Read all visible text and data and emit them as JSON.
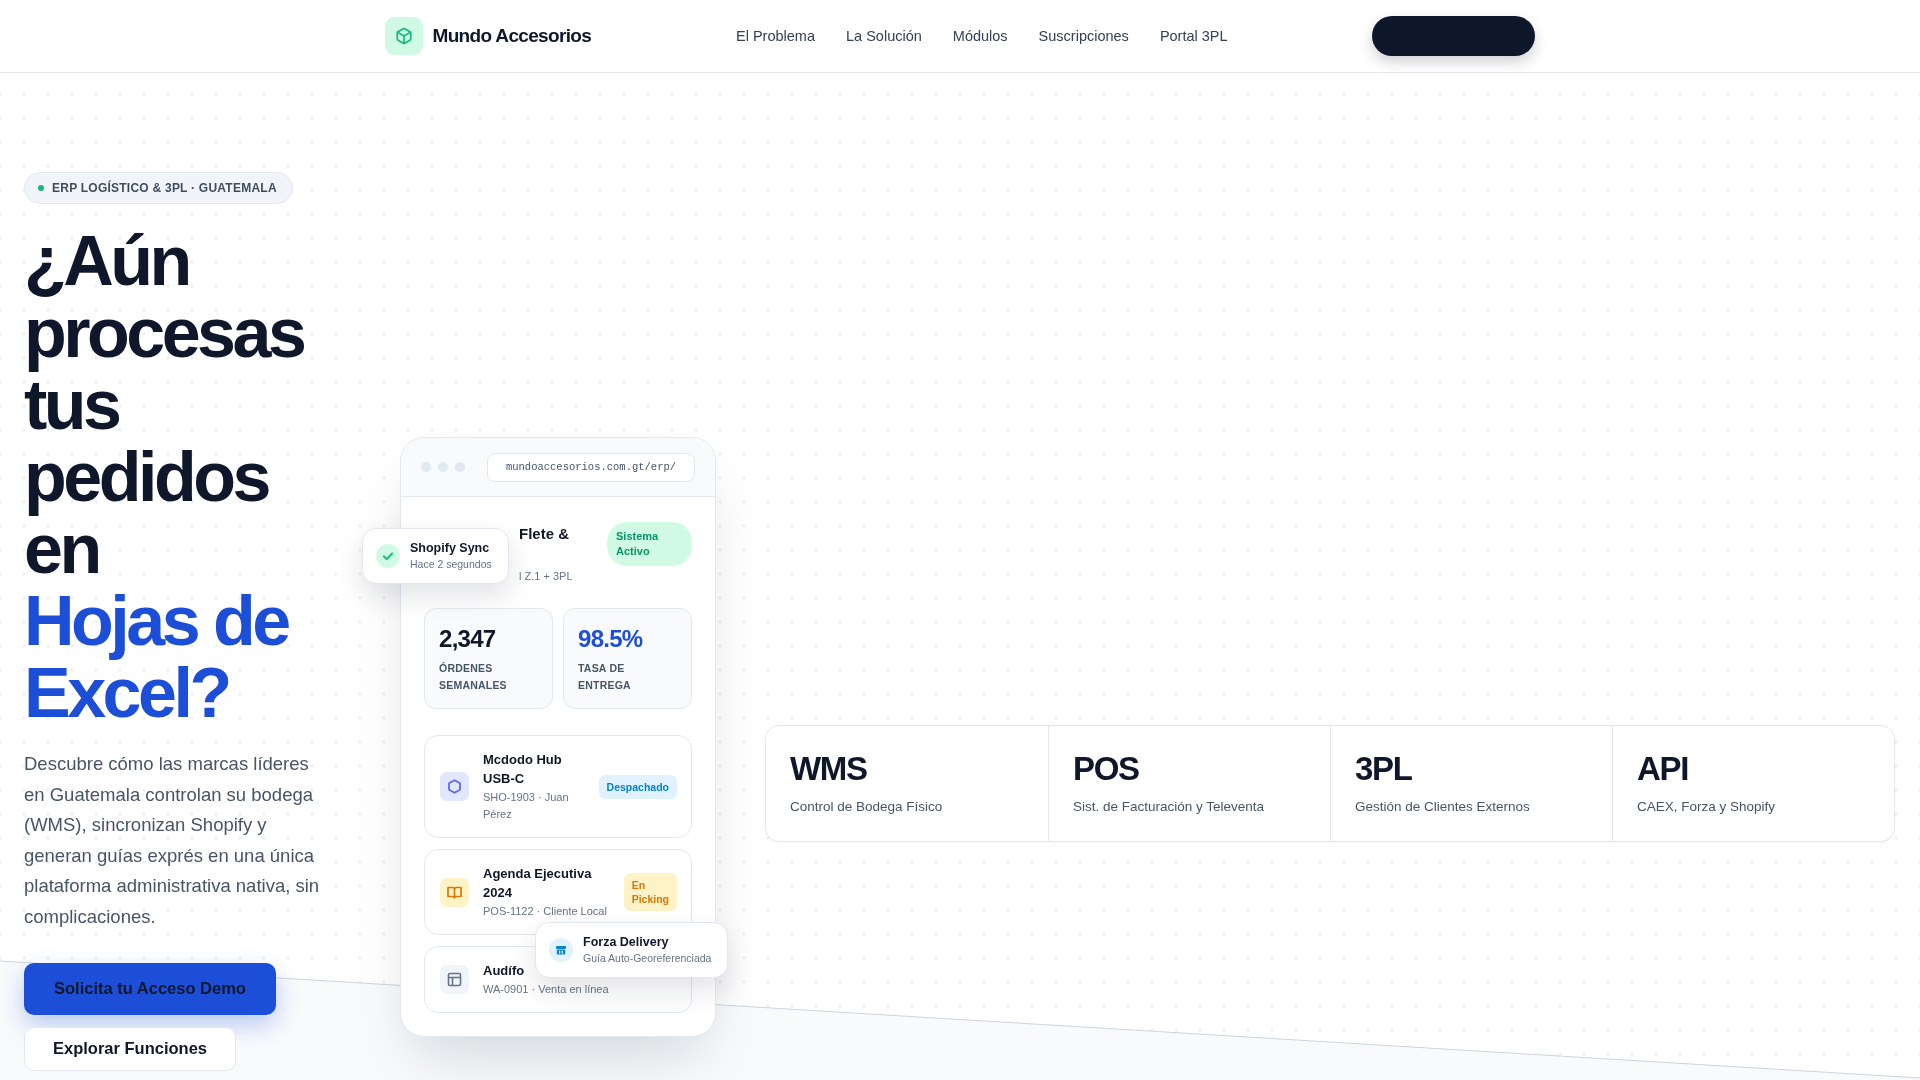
{
  "header": {
    "brand": "Mundo Accesorios",
    "nav": [
      "El Problema",
      "La Solución",
      "Módulos",
      "Suscripciones",
      "Portal 3PL"
    ]
  },
  "hero": {
    "badge": "ERP LOGÍSTICO & 3PL · GUATEMALA",
    "heading": "¿Aún procesas tus pedidos en",
    "heading_highlight": "Hojas de Excel?",
    "description": "Descubre cómo las marcas líderes en Guatemala controlan su bodega (WMS), sincronizan Shopify y generan guías exprés en una única plataforma administrativa nativa, sin complicaciones.",
    "buttons": [
      {
        "label": "Solicita tu Acceso Demo",
        "kind": "primary"
      },
      {
        "label": "Explorar Funciones",
        "kind": "secondary"
      }
    ]
  },
  "dashboard_preview": {
    "url": "mundoaccesorios.com.gt/erp/",
    "title": "Flete &",
    "subtitle": "l Z.1 + 3PL",
    "status": "Sistema Activo",
    "stats": [
      {
        "value": "2,347",
        "label": "ÓRDENES SEMANALES",
        "kind": "neutral"
      },
      {
        "value": "98.5%",
        "label": "TASA DE ENTREGA",
        "kind": "accent"
      }
    ],
    "orders": [
      {
        "product": "Mcdodo Hub USB-C",
        "detail": "SHO-1903 · Juan Pérez",
        "status": "Despachado",
        "kind": "dispatched"
      },
      {
        "product": "Agenda Ejecutiva 2024",
        "detail": "POS-1122 · Cliente Local",
        "status": "En Picking",
        "kind": "picking"
      },
      {
        "product": "Audífo",
        "detail": "WA-0901 · Venta en línea",
        "kind": "online"
      }
    ],
    "notifications": [
      {
        "title": "Shopify Sync",
        "subtitle": "Hace 2 segundos",
        "kind": "sync"
      },
      {
        "title": "Forza Delivery",
        "subtitle": "Guía Auto-Georeferenciada",
        "kind": "delivery"
      }
    ]
  },
  "modules": [
    {
      "code": "WMS",
      "description": "Control de Bodega Físico"
    },
    {
      "code": "POS",
      "description": "Sist. de Facturación y Televenta"
    },
    {
      "code": "3PL",
      "description": "Gestión de Clientes Externos"
    },
    {
      "code": "API",
      "description": "CAEX, Forza y Shopify"
    }
  ]
}
